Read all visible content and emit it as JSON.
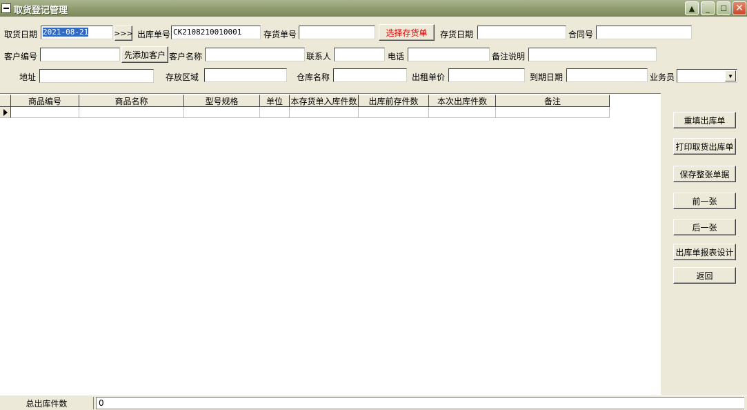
{
  "window": {
    "title": "取货登记管理"
  },
  "form": {
    "pickup_date_label": "取货日期",
    "pickup_date_value": "2021-08-21",
    "nav_button": ">>>",
    "outbound_no_label": "出库单号",
    "outbound_no_value": "CK2108210010001",
    "stock_no_label": "存货单号",
    "stock_no_value": "",
    "select_stock_button": "选择存货单",
    "stock_date_label": "存货日期",
    "stock_date_value": "",
    "contract_no_label": "合同号",
    "contract_no_value": "",
    "customer_no_label": "客户编号",
    "customer_no_value": "",
    "add_customer_button": "先添加客户",
    "customer_name_label": "客户名称",
    "customer_name_value": "",
    "contact_label": "联系人",
    "contact_value": "",
    "phone_label": "电话",
    "phone_value": "",
    "remark_label": "备注说明",
    "remark_value": "",
    "address_label": "地址",
    "address_value": "",
    "storage_area_label": "存放区域",
    "storage_area_value": "",
    "warehouse_label": "仓库名称",
    "warehouse_value": "",
    "rent_price_label": "出租单价",
    "rent_price_value": "",
    "expiry_date_label": "到期日期",
    "expiry_date_value": "",
    "salesperson_label": "业务员",
    "salesperson_value": ""
  },
  "grid": {
    "columns": [
      "商品编号",
      "商品名称",
      "型号规格",
      "单位",
      "本存货单入库件数",
      "出库前存件数",
      "本次出库件数",
      "备注"
    ],
    "rows": [
      [
        "",
        "",
        "",
        "",
        "",
        "",
        "",
        ""
      ]
    ]
  },
  "side_buttons": {
    "refill": "重填出库单",
    "print": "打印取货出库单",
    "save": "保存整张单据",
    "prev": "前一张",
    "next": "后一张",
    "report_design": "出库单报表设计",
    "back": "返回"
  },
  "footer": {
    "total_label": "总出库件数",
    "total_value": "0"
  }
}
